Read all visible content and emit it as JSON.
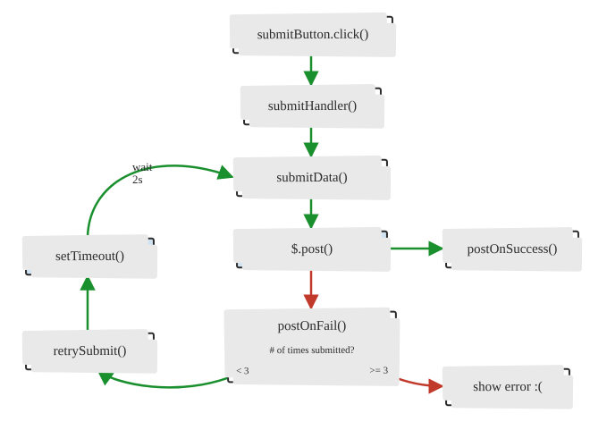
{
  "chart_data": {
    "type": "flowchart",
    "title": "",
    "nodes": [
      {
        "id": "n0",
        "label": "submitButton.click()",
        "highlight": false
      },
      {
        "id": "n1",
        "label": "submitHandler()",
        "highlight": false
      },
      {
        "id": "n2",
        "label": "submitData()",
        "highlight": false
      },
      {
        "id": "n3",
        "label": "$.post()",
        "highlight": true
      },
      {
        "id": "n4",
        "label": "postOnSuccess()",
        "highlight": false
      },
      {
        "id": "n5",
        "label": "postOnFail()",
        "highlight": false,
        "question": "# of times submitted?",
        "left_branch_label": "< 3",
        "right_branch_label": ">= 3"
      },
      {
        "id": "n6",
        "label": "show error :(",
        "highlight": false
      },
      {
        "id": "n7",
        "label": "retrySubmit()",
        "highlight": false
      },
      {
        "id": "n8",
        "label": "setTimeout()",
        "highlight": true
      }
    ],
    "edges": [
      {
        "from": "n0",
        "to": "n1",
        "color": "green"
      },
      {
        "from": "n1",
        "to": "n2",
        "color": "green"
      },
      {
        "from": "n2",
        "to": "n3",
        "color": "green"
      },
      {
        "from": "n3",
        "to": "n4",
        "color": "green"
      },
      {
        "from": "n3",
        "to": "n5",
        "color": "red"
      },
      {
        "from": "n5",
        "to": "n6",
        "color": "red",
        "condition": ">= 3"
      },
      {
        "from": "n5",
        "to": "n7",
        "color": "green",
        "condition": "< 3"
      },
      {
        "from": "n7",
        "to": "n8",
        "color": "green"
      },
      {
        "from": "n8",
        "to": "n2",
        "color": "green",
        "label": "wait\n2s"
      }
    ],
    "wait_label": "wait\n2s"
  },
  "colors": {
    "green": "#1a8f2d",
    "red": "#c0392b",
    "highlight_bg": "#cfe3f2"
  }
}
